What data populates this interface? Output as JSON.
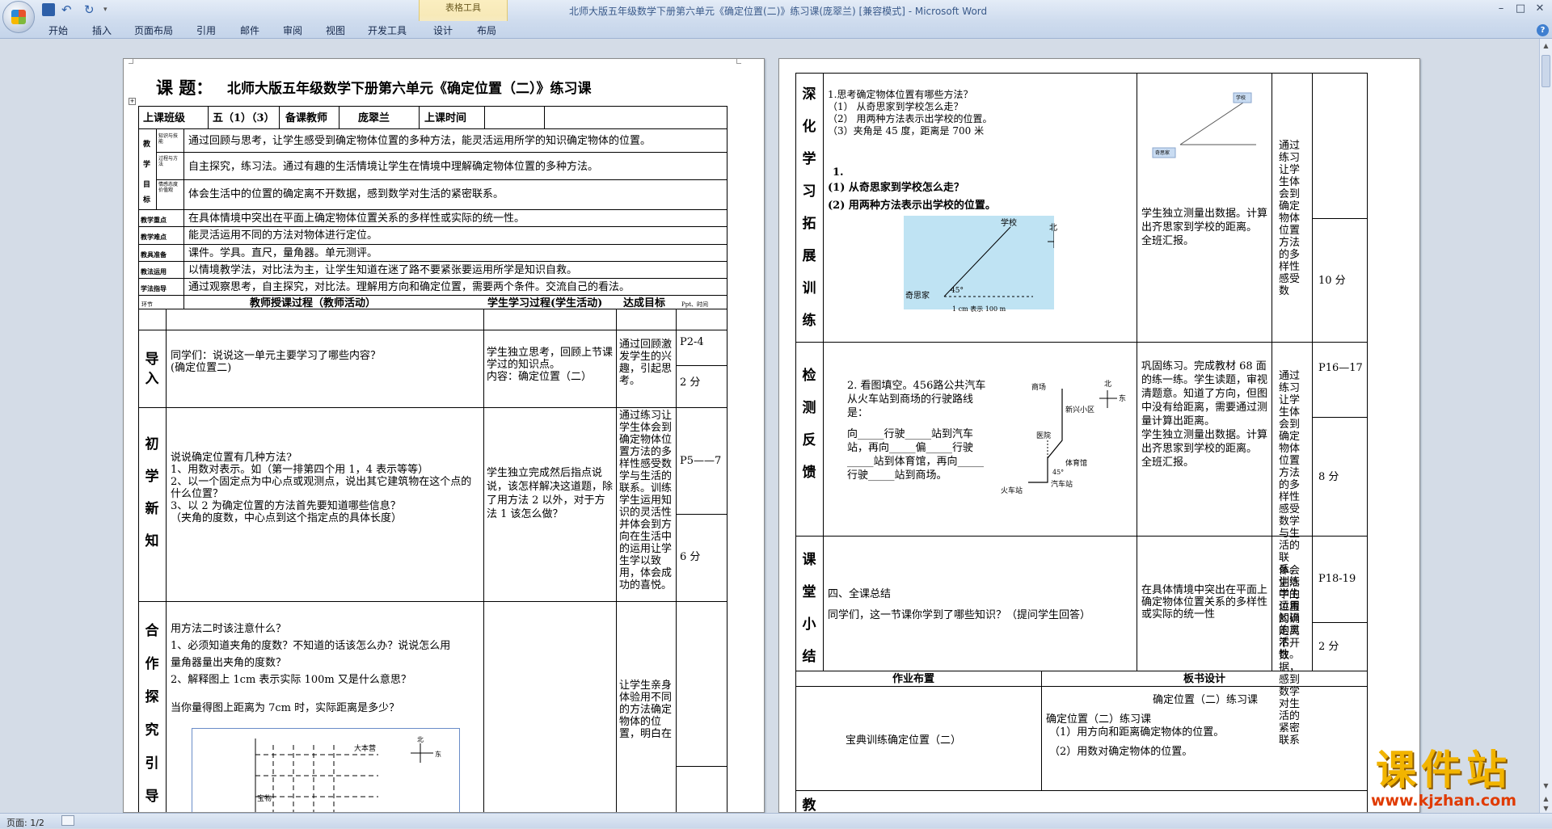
{
  "window": {
    "title": "北师大版五年级数学下册第六单元《确定位置(二)》练习课(庞翠兰) [兼容模式] - Microsoft Word",
    "context_tab_group": "表格工具",
    "controls": [
      "–",
      "□",
      "✕"
    ]
  },
  "ribbon": {
    "tabs": [
      "开始",
      "插入",
      "页面布局",
      "引用",
      "邮件",
      "审阅",
      "视图",
      "开发工具",
      "设计",
      "布局"
    ]
  },
  "status": {
    "page": "页面: 1/2"
  },
  "watermark": {
    "brand": "课件站",
    "url": "www.kjzhan.com"
  },
  "page1": {
    "lesson_label": "课 题：",
    "lesson_title": "北师大版五年级数学下册第六单元《确定位置（二）》练习课",
    "info": {
      "class_label": "上课班级",
      "class_value": "五（1）（3）",
      "teacher_label": "备课教师",
      "teacher_value": "庞翠兰",
      "time_label": "上课时间"
    },
    "goals_side": [
      "教",
      "学",
      "目",
      "标"
    ],
    "goal_labels": [
      "知识与技能",
      "过程与方法",
      "情感态度价值观"
    ],
    "goals": [
      "通过回顾与思考，让学生感受到确定物体位置的多种方法，能灵活运用所学的知识确定物体的位置。",
      "自主探究，练习法。通过有趣的生活情境让学生在情境中理解确定物体位置的多种方法。",
      "体会生活中的位置的确定离不开数据，感到数学对生活的紧密联系。"
    ],
    "rows": [
      {
        "label": "教学重点",
        "text": "在具体情境中突出在平面上确定物体位置关系的多样性或实际的统一性。"
      },
      {
        "label": "教学难点",
        "text": "能灵活运用不同的方法对物体进行定位。"
      },
      {
        "label": "教具准备",
        "text": "课件。学具。直尺，量角器。单元测评。"
      },
      {
        "label": "教法运用",
        "text": "以情境教学法，对比法为主，让学生知道在迷了路不要紧张要运用所学是知识自救。"
      },
      {
        "label": "学法指导",
        "text": "通过观察思考，自主探究，对比法。理解用方向和确定位置，需要两个条件。交流自己的看法。"
      }
    ],
    "process_header": {
      "step": "环节",
      "teacher": "教师授课过程（教师活动）",
      "student": "学生学习过程(学生活动)",
      "goal": "达成目标",
      "ppt": "Ppt、时间"
    },
    "sec1": {
      "label": [
        "导",
        "入"
      ],
      "teacher": "同学们：说说这一单元主要学习了哪些内容？\n(确定位置二)",
      "student": "学生独立思考，回顾上节课学过的知识点。\n内容：确定位置（二）",
      "goal": "通过回顾激发学生的兴趣，引起思考。",
      "ppt": "P2-4",
      "time": "2 分"
    },
    "sec2": {
      "label": [
        "初",
        "学",
        "新",
        "知"
      ],
      "teacher": "说说确定位置有几种方法?\n1、用数对表示。如（第一排第四个用 1，4 表示等等）\n2、以一个固定点为中心点或观测点，说出其它建筑物在这个点的什么位置？\n3、以 2 为确定位置的方法首先要知道哪些信息？\n    （夹角的度数，中心点到这个指定点的具体长度）",
      "student": "学生独立完成然后指点说说，该怎样解决这道题，除了用方法 2 以外，对于方法 1 该怎么做？",
      "goal": "通过练习让学生体会到确定物体位置方法的多样性感受数学与生活的联系。训练学生运用知识的灵活性并体会到方向在生活中的运用让学生学以致用，体会成功的喜悦。",
      "ppt": "P5——7",
      "time": "6 分"
    },
    "sec3": {
      "label": [
        "合",
        "作",
        "探",
        "究",
        "引",
        "导"
      ],
      "teacher": "用方法二时该注意什么？\n1、必须知道夹角的度数？不知道的话该怎么办？说说怎么用\n    量角器量出夹角的度数？\n2、解释图上 1cm 表示实际 100m 又是什么意思？",
      "question": "当你量得图上距离为 7cm 时，实际距离是多少？",
      "goal": "让学生亲身体验用不同的方法确定物体的位置，明白在",
      "map_labels": {
        "north": "北",
        "east": "东",
        "a": "大本营",
        "b": "宝物"
      }
    }
  },
  "page2": {
    "deep": {
      "label": [
        "深",
        "化",
        "学",
        "习",
        "拓",
        "展",
        "训",
        "练"
      ],
      "teacher": "1.思考确定物体位置有哪些方法？\n（1）  从奇思家到学校怎么走？\n（2）  用两种方法表示出学校的位置。\n（3）夹角是 45 度，距离是 700 米",
      "q_num": "1.",
      "q1": "(1) 从奇思家到学校怎么走？",
      "q2": "(2) 用两种方法表示出学校的位置。",
      "figure": {
        "school": "学校",
        "north": "北",
        "east": "东",
        "home": "奇思家",
        "angle": "45°",
        "scale": "1 cm 表示 100 m"
      },
      "mini_figure": {
        "school": "学校",
        "home": "奇思家"
      },
      "student": "学生独立测量出数据。计算出齐思家到学校的距离。\n全班汇报。",
      "goal": "通过练习让学生体会到确定物体位置方法的多样性感受数",
      "time": "10 分"
    },
    "check": {
      "label": [
        "检",
        "测",
        "反",
        "馈"
      ],
      "question": "2. 看图填空。456路公共汽车从火车站到商场的行驶路线是：",
      "fill": "向_____行驶_____站到汽车站，再向_____偏_____行驶_____站到体育馆，再向_____行驶_____站到商场。",
      "map": {
        "mall": "商场",
        "xinxing": "新兴小区",
        "hospital": "医院",
        "gym": "体育馆",
        "train": "火车站",
        "bus": "汽车站",
        "north": "北",
        "east": "东",
        "angle": "45°"
      },
      "student": "巩固练习。完成教材 68 面的练一练。学生读题，审视清题意。知道了方向，但图中没有给距离，需要通过测量计算出距离。\n学生独立测量出数据。计算出齐思家到学校的距离。\n全班汇报。",
      "goal": "通过练习让学生体会到确定物体位置方法的多样性感受数学与生活的联系。训练学生运用知识的灵活性。",
      "ppt": "P16—17",
      "time": "8 分"
    },
    "summary": {
      "label": [
        "课",
        "堂",
        "小",
        "结"
      ],
      "teacher": "四、全课总结\n同学们，这一节课你学到了哪些知识？（提问学生回答）",
      "student": "在具体情境中突出在平面上确定物体位置关系的多样性或实际的统一性",
      "goal": "体会生活中的位置的确定离不开数据，感到数学对生活的紧密联系",
      "ppt": "P18-19",
      "time": "2 分"
    },
    "homework": {
      "title": "作业布置",
      "content": "宝典训练确定位置（二）"
    },
    "board": {
      "title": "板书设计",
      "content": "确定位置（二）练习课",
      "lines": [
        "确定位置（二）练习课",
        "（1）用方向和距离确定物体的位置。",
        "（2）用数对确定物体的位置。"
      ]
    },
    "bottom_label": "教"
  }
}
